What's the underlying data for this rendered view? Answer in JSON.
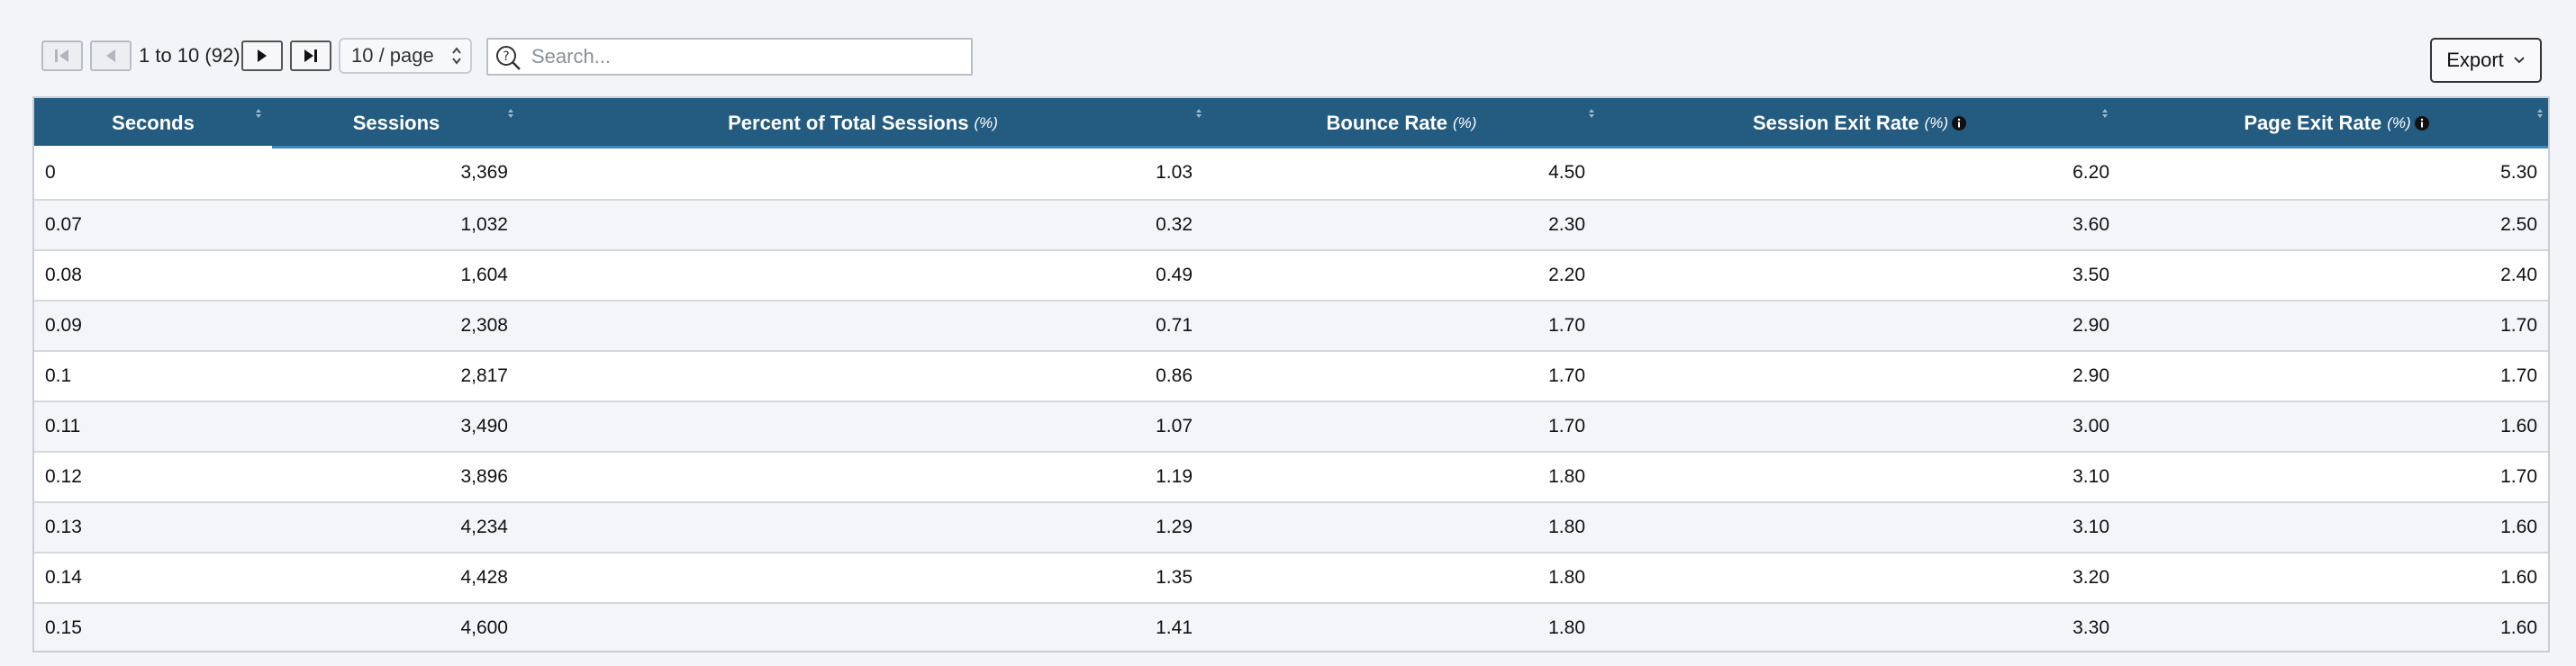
{
  "pagination": {
    "range_text": "1 to 10 (92)",
    "page_size_value": "10 / page",
    "first_disabled": true,
    "prev_disabled": true
  },
  "search": {
    "placeholder": "Search..."
  },
  "export": {
    "label": "Export"
  },
  "table": {
    "columns": [
      {
        "label": "Seconds",
        "unit": ""
      },
      {
        "label": "Sessions",
        "unit": ""
      },
      {
        "label": "Percent of Total Sessions",
        "unit": "(%)"
      },
      {
        "label": "Bounce Rate",
        "unit": "(%)"
      },
      {
        "label": "Session Exit Rate",
        "unit": "(%)"
      },
      {
        "label": "Page Exit Rate",
        "unit": "(%)"
      }
    ],
    "rows": [
      [
        "0",
        "3,369",
        "1.03",
        "4.50",
        "6.20",
        "5.30"
      ],
      [
        "0.07",
        "1,032",
        "0.32",
        "2.30",
        "3.60",
        "2.50"
      ],
      [
        "0.08",
        "1,604",
        "0.49",
        "2.20",
        "3.50",
        "2.40"
      ],
      [
        "0.09",
        "2,308",
        "0.71",
        "1.70",
        "2.90",
        "1.70"
      ],
      [
        "0.1",
        "2,817",
        "0.86",
        "1.70",
        "2.90",
        "1.70"
      ],
      [
        "0.11",
        "3,490",
        "1.07",
        "1.70",
        "3.00",
        "1.60"
      ],
      [
        "0.12",
        "3,896",
        "1.19",
        "1.80",
        "3.10",
        "1.70"
      ],
      [
        "0.13",
        "4,234",
        "1.29",
        "1.80",
        "3.10",
        "1.60"
      ],
      [
        "0.14",
        "4,428",
        "1.35",
        "1.80",
        "3.20",
        "1.60"
      ],
      [
        "0.15",
        "4,600",
        "1.41",
        "1.80",
        "3.30",
        "1.60"
      ]
    ]
  },
  "colors": {
    "header_bg": "#245b80",
    "header_accent": "#3f86c0"
  },
  "icons": [
    "first-page-icon",
    "prev-page-icon",
    "next-page-icon",
    "last-page-icon",
    "select-chevron-icon",
    "search-help-icon",
    "chevron-down-icon",
    "sort-icon",
    "info-icon"
  ]
}
